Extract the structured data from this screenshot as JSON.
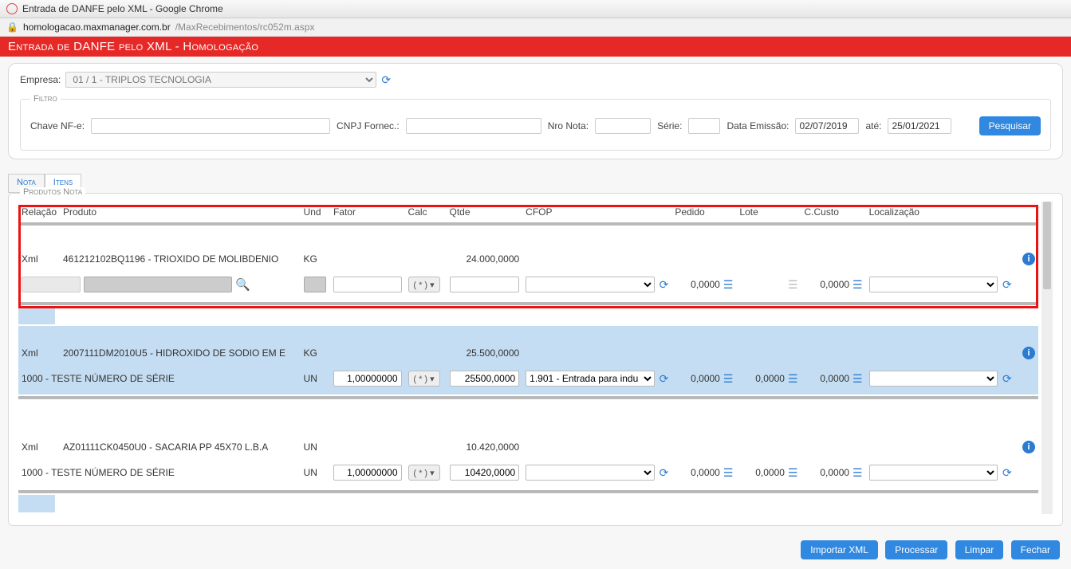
{
  "window": {
    "title": "Entrada de DANFE pelo XML - Google Chrome",
    "url_host": "homologacao.maxmanager.com.br",
    "url_path": "/MaxRecebimentos/rc052m.aspx"
  },
  "header": {
    "title": "Entrada de DANFE pelo XML  - Homologação"
  },
  "empresa": {
    "label": "Empresa:",
    "value": "01 / 1 - TRIPLOS TECNOLOGIA"
  },
  "filtro": {
    "legend": "Filtro",
    "chave_label": "Chave NF-e:",
    "chave_value": "",
    "cnpj_label": "CNPJ Fornec.:",
    "cnpj_value": "",
    "nro_label": "Nro Nota:",
    "nro_value": "",
    "serie_label": "Série:",
    "serie_value": "",
    "emissao_label": "Data Emissão:",
    "emissao_from": "02/07/2019",
    "emissao_ate_label": "até:",
    "emissao_to": "25/01/2021",
    "pesquisar": "Pesquisar"
  },
  "tabs": {
    "nota": "Nota",
    "itens": "Itens"
  },
  "products": {
    "title": "Produtos Nota",
    "columns": {
      "relacao": "Relação",
      "produto": "Produto",
      "und": "Und",
      "fator": "Fator",
      "calc": "Calc",
      "qtde": "Qtde",
      "cfop": "CFOP",
      "pedido": "Pedido",
      "lote": "Lote",
      "ccusto": "C.Custo",
      "local": "Localização"
    },
    "calc_token": "( * )",
    "rows": [
      {
        "xml_rel": "Xml",
        "xml_prod": "461212102BQ1196 - TRIOXIDO DE MOLIBDENIO",
        "xml_und": "KG",
        "xml_qtde": "24.000,0000",
        "edit_rel_code": "",
        "edit_prod": "",
        "edit_und": "",
        "edit_fator": "",
        "edit_qtde": "",
        "edit_cfop": "",
        "edit_pedido": "0,0000",
        "edit_lote": "",
        "edit_ccusto": "0,0000",
        "edit_local": "",
        "highlight": true,
        "lote_muted": true
      },
      {
        "xml_rel": "Xml",
        "xml_prod": "2007111DM2010U5 - HIDROXIDO DE SODIO EM E",
        "xml_und": "KG",
        "xml_qtde": "25.500,0000",
        "edit_rel_code": "1000 - TESTE NÚMERO DE SÉRIE",
        "edit_und": "UN",
        "edit_fator": "1,00000000",
        "edit_qtde": "25500,0000",
        "edit_cfop": "1.901 - Entrada para indu",
        "edit_pedido": "0,0000",
        "edit_lote": "0,0000",
        "edit_ccusto": "0,0000",
        "edit_local": "",
        "blue": true
      },
      {
        "xml_rel": "Xml",
        "xml_prod": "AZ01111CK0450U0 - SACARIA PP 45X70 L.B.A",
        "xml_und": "UN",
        "xml_qtde": "10.420,0000",
        "edit_rel_code": "1000 - TESTE NÚMERO DE SÉRIE",
        "edit_und": "UN",
        "edit_fator": "1,00000000",
        "edit_qtde": "10420,0000",
        "edit_cfop": "",
        "edit_pedido": "0,0000",
        "edit_lote": "0,0000",
        "edit_ccusto": "0,0000",
        "edit_local": ""
      }
    ]
  },
  "actions": {
    "importar": "Importar XML",
    "processar": "Processar",
    "limpar": "Limpar",
    "fechar": "Fechar"
  }
}
